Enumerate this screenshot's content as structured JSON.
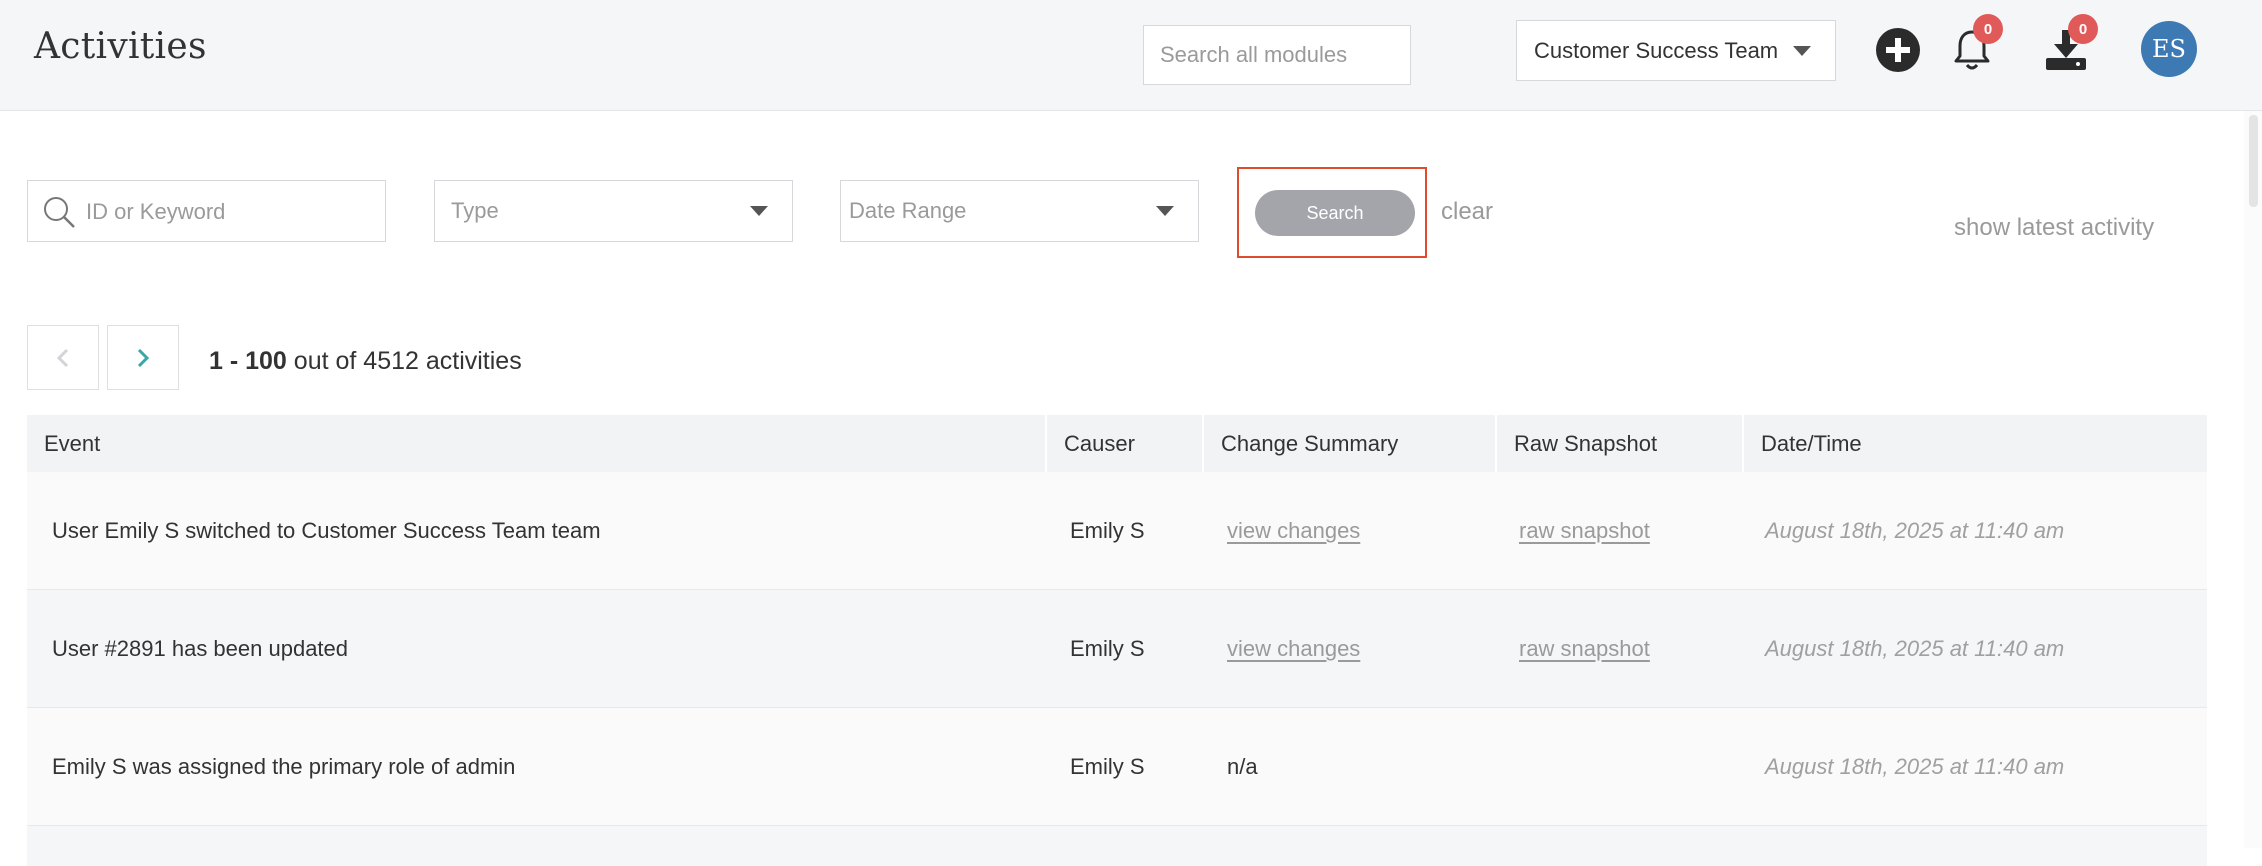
{
  "header": {
    "title": "Activities",
    "global_search_placeholder": "Search all modules",
    "team_selector": "Customer Success Team",
    "notifications_count": "0",
    "downloads_count": "0",
    "avatar_initials": "ES"
  },
  "filters": {
    "keyword_placeholder": "ID or Keyword",
    "type_placeholder": "Type",
    "date_range_placeholder": "Date Range",
    "search_label": "Search",
    "clear_label": "clear",
    "show_latest_label": "show latest activity"
  },
  "pagination": {
    "range": "1 - 100",
    "suffix": " out of 4512 activities"
  },
  "table": {
    "columns": [
      "Event",
      "Causer",
      "Change Summary",
      "Raw Snapshot",
      "Date/Time"
    ],
    "rows": [
      {
        "event": "User Emily S switched to Customer Success Team team",
        "causer": "Emily S",
        "change_summary": "view changes",
        "raw_snapshot": "raw snapshot",
        "datetime": "August 18th, 2025 at 11:40 am"
      },
      {
        "event": "User #2891 has been updated",
        "causer": "Emily S",
        "change_summary": "view changes",
        "raw_snapshot": "raw snapshot",
        "datetime": "August 18th, 2025 at 11:40 am"
      },
      {
        "event": "Emily S was assigned the primary role of admin",
        "causer": "Emily S",
        "change_summary": "n/a",
        "raw_snapshot": "",
        "datetime": "August 18th, 2025 at 11:40 am"
      }
    ]
  },
  "colors": {
    "avatar": "#3d7ab3",
    "badge": "#e05a5a",
    "highlight": "#e04b2b",
    "search_button": "#a4a4ab",
    "pager_arrow": "#3aa6a6"
  },
  "icons": [
    "search-icon",
    "plus-circle-icon",
    "bell-icon",
    "download-icon",
    "chevron-left-icon",
    "chevron-right-icon",
    "caret-down-icon"
  ]
}
